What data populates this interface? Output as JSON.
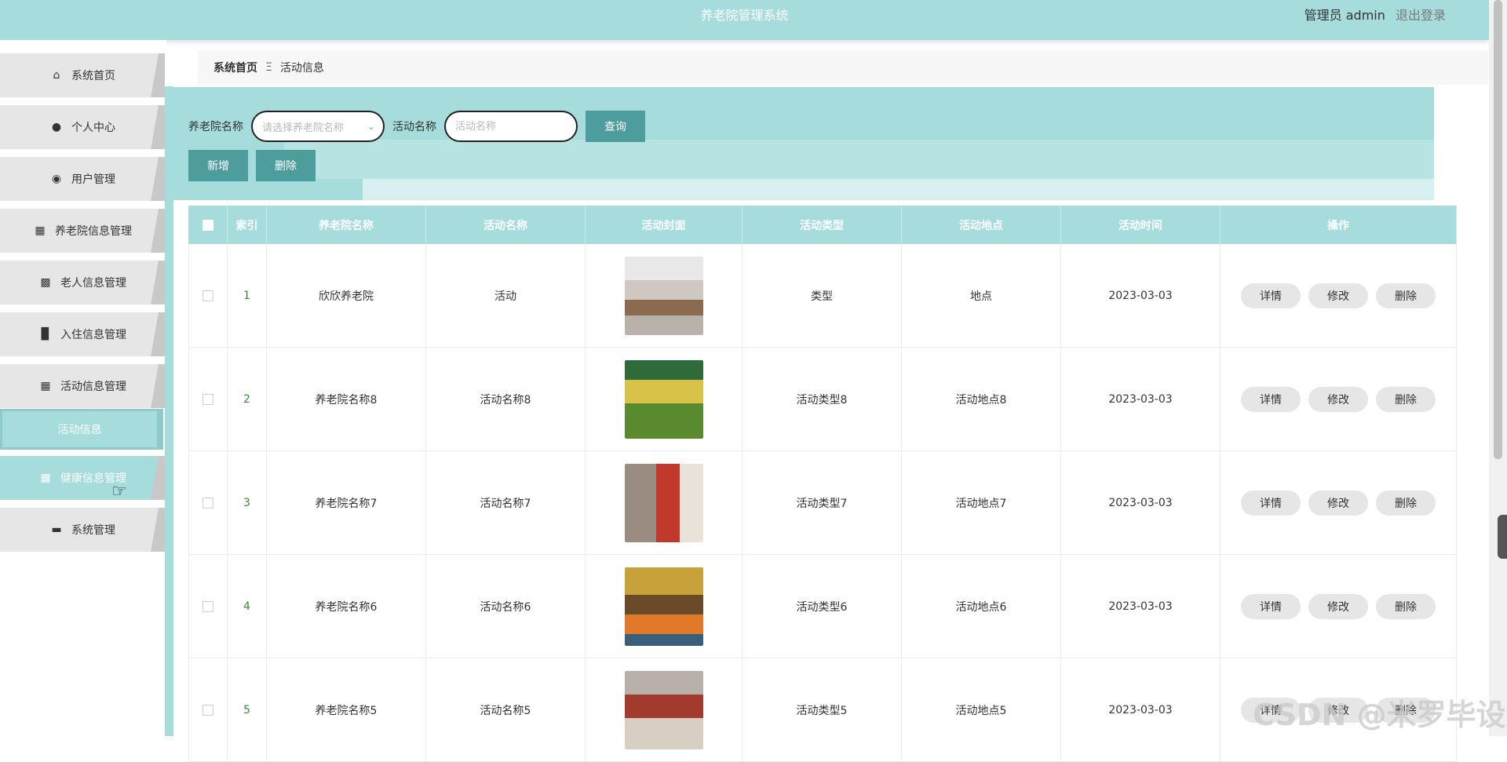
{
  "header": {
    "title": "养老院管理系统",
    "user_label": "管理员 admin",
    "logout_label": "退出登录"
  },
  "sidebar": {
    "items": [
      {
        "label": "系统首页",
        "icon": "home-icon"
      },
      {
        "label": "个人中心",
        "icon": "user-icon"
      },
      {
        "label": "用户管理",
        "icon": "bulb-icon"
      },
      {
        "label": "养老院信息管理",
        "icon": "book-icon"
      },
      {
        "label": "老人信息管理",
        "icon": "clipboard-icon"
      },
      {
        "label": "入住信息管理",
        "icon": "bar-chart-icon"
      },
      {
        "label": "活动信息管理",
        "icon": "grid-icon"
      },
      {
        "label": "健康信息管理",
        "icon": "grid-icon"
      },
      {
        "label": "系统管理",
        "icon": "chat-icon"
      }
    ],
    "submenu_active": "活动信息"
  },
  "breadcrumb": {
    "home": "系统首页",
    "separator": "Ξ",
    "current": "活动信息"
  },
  "search": {
    "name_label": "养老院名称",
    "name_placeholder": "请选择养老院名称",
    "activity_label": "活动名称",
    "activity_placeholder": "活动名称",
    "query_button": "查询"
  },
  "actions": {
    "add_button": "新增",
    "delete_button": "删除"
  },
  "table": {
    "headers": [
      "索引",
      "养老院名称",
      "活动名称",
      "活动封面",
      "活动类型",
      "活动地点",
      "活动时间",
      "操作"
    ],
    "op_labels": {
      "detail": "详情",
      "edit": "修改",
      "delete": "删除"
    },
    "rows": [
      {
        "index": "1",
        "nursing_home": "欣欣养老院",
        "activity_name": "活动",
        "activity_type": "类型",
        "location": "地点",
        "time": "2023-03-03"
      },
      {
        "index": "2",
        "nursing_home": "养老院名称8",
        "activity_name": "活动名称8",
        "activity_type": "活动类型8",
        "location": "活动地点8",
        "time": "2023-03-03"
      },
      {
        "index": "3",
        "nursing_home": "养老院名称7",
        "activity_name": "活动名称7",
        "activity_type": "活动类型7",
        "location": "活动地点7",
        "time": "2023-03-03"
      },
      {
        "index": "4",
        "nursing_home": "养老院名称6",
        "activity_name": "活动名称6",
        "activity_type": "活动类型6",
        "location": "活动地点6",
        "time": "2023-03-03"
      },
      {
        "index": "5",
        "nursing_home": "养老院名称5",
        "activity_name": "活动名称5",
        "activity_type": "活动类型5",
        "location": "活动地点5",
        "time": "2023-03-03"
      }
    ]
  },
  "watermark": "CSDN @米罗毕设",
  "colors": {
    "primary": "#a6dcdc",
    "button": "#4e9d9d",
    "menu_bg": "#e6e6e6"
  }
}
